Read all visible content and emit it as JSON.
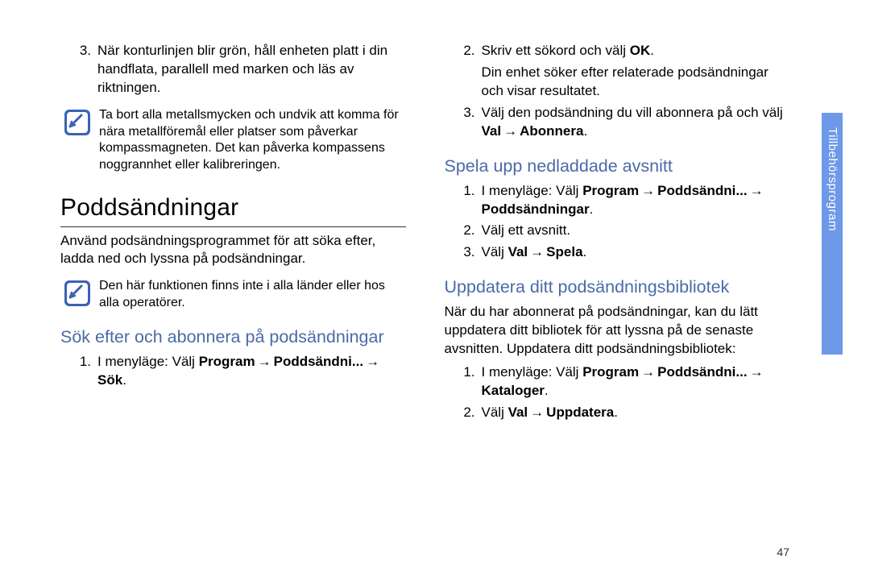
{
  "side_tab_label": "Tillbehörsprogram",
  "page_number": "47",
  "left": {
    "compass_step3_num": "3.",
    "compass_step3_text": "När konturlinjen blir grön, håll enheten platt i din handflata, parallell med marken och läs av riktningen.",
    "compass_note": "Ta bort alla metallsmycken och undvik att komma för nära metallföremål eller platser som påverkar kompassmagneten. Det kan påverka kompassens noggrannhet eller kalibreringen.",
    "h1": "Poddsändningar",
    "intro": "Använd podsändningsprogrammet för att söka efter, ladda ned och lyssna på podsändningar.",
    "note2": "Den här funktionen finns inte i alla länder eller hos alla operatörer.",
    "h2": "Sök efter och abonnera på podsändningar",
    "step1_num": "1.",
    "step1_pre": "I menyläge: Välj ",
    "step1_b1": "Program",
    "step1_arrow": "→",
    "step1_b2": "Poddsändni...",
    "step1_arrow2": "→",
    "step1_b3": "Sök",
    "step1_dot": "."
  },
  "right": {
    "step2_num": "2.",
    "step2_pre": "Skriv ett sökord och välj ",
    "step2_b": "OK",
    "step2_dot": ".",
    "step2_line2": "Din enhet söker efter relaterade podsändningar och visar resultatet.",
    "step3_num": "3.",
    "step3_pre": "Välj den podsändning du vill abonnera på och välj ",
    "step3_b1": "Val",
    "step3_arrow": "→",
    "step3_b2": "Abonnera",
    "step3_dot": ".",
    "h2a": "Spela upp nedladdade avsnitt",
    "a1_num": "1.",
    "a1_pre": "I menyläge: Välj ",
    "a1_b1": "Program",
    "a1_arrow": "→",
    "a1_b2": "Poddsändni...",
    "a1_arrow2": "→",
    "a1_b3": "Poddsändningar",
    "a1_dot": ".",
    "a2_num": "2.",
    "a2_text": "Välj ett avsnitt.",
    "a3_num": "3.",
    "a3_pre": "Välj ",
    "a3_b1": "Val",
    "a3_arrow": "→",
    "a3_b2": "Spela",
    "a3_dot": ".",
    "h2b": "Uppdatera ditt podsändningsbibliotek",
    "b_intro": "När du har abonnerat på podsändningar, kan du lätt uppdatera ditt bibliotek för att lyssna på de senaste avsnitten. Uppdatera ditt podsändningsbibliotek:",
    "b1_num": "1.",
    "b1_pre": "I menyläge: Välj ",
    "b1_b1": "Program",
    "b1_arrow": "→",
    "b1_b2": "Poddsändni...",
    "b1_arrow2": "→",
    "b1_b3": "Kataloger",
    "b1_dot": ".",
    "b2_num": "2.",
    "b2_pre": "Välj ",
    "b2_b1": "Val",
    "b2_arrow": "→",
    "b2_b2": "Uppdatera",
    "b2_dot": "."
  }
}
